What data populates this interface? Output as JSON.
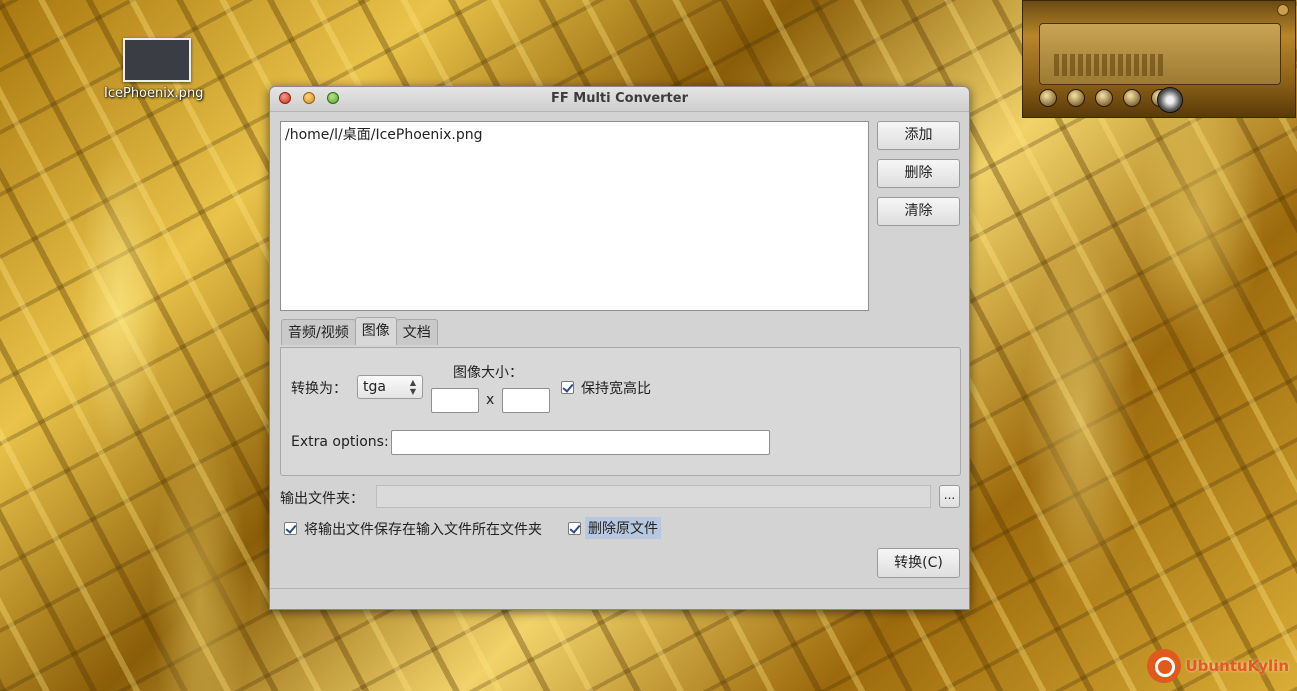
{
  "desktop": {
    "icon_label": "IcePhoenix.png",
    "brand": "UbuntuKylin"
  },
  "window": {
    "title": "FF Multi Converter",
    "files": [
      "/home/l/桌面/IcePhoenix.png"
    ],
    "buttons": {
      "add": "添加",
      "delete": "删除",
      "clear": "清除",
      "convert": "转换(C)",
      "browse": "..."
    },
    "tabs": [
      {
        "label": "音频/视频",
        "active": false
      },
      {
        "label": "图像",
        "active": true
      },
      {
        "label": "文档",
        "active": false
      }
    ],
    "image_tab": {
      "convert_to_label": "转换为：",
      "format_value": "tga",
      "image_size_label": "图像大小：",
      "size_separator": "x",
      "keep_ratio_label": "保持宽高比",
      "keep_ratio_checked": true,
      "extra_options_label": "Extra options:"
    },
    "output_folder_label": "输出文件夹：",
    "save_in_input_folder_label": "将输出文件保存在输入文件所在文件夹",
    "save_in_input_folder_checked": true,
    "delete_original_label": "删除原文件",
    "delete_original_checked": true
  }
}
